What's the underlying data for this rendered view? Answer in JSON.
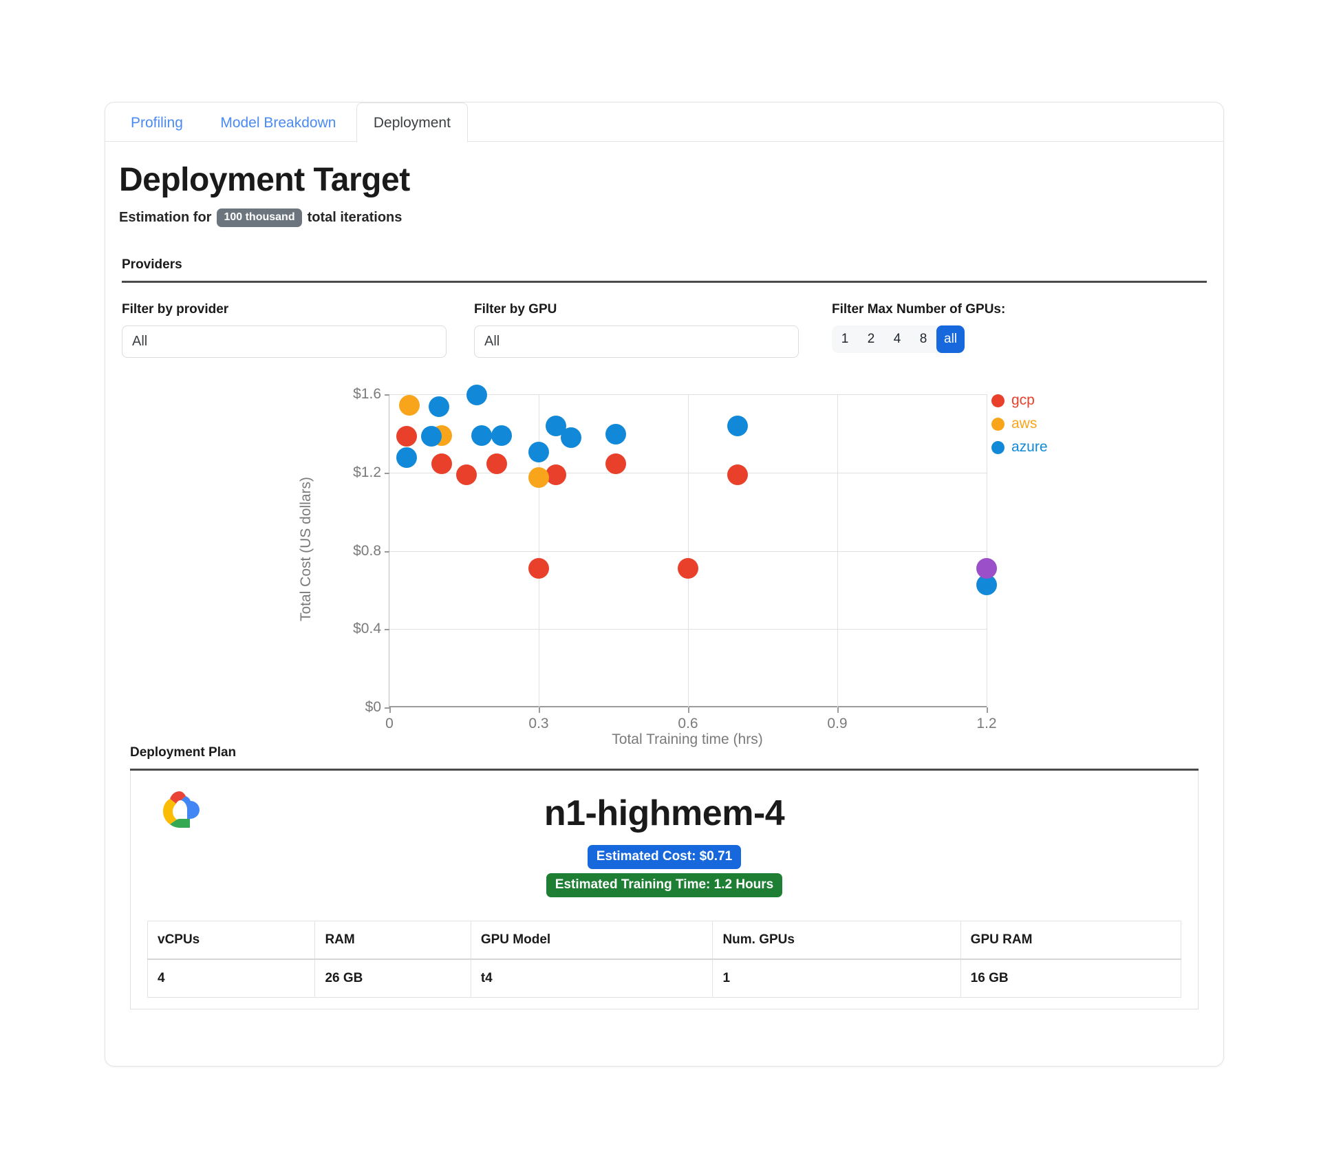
{
  "tabs": [
    {
      "label": "Profiling",
      "active": false
    },
    {
      "label": "Model Breakdown",
      "active": false
    },
    {
      "label": "Deployment",
      "active": true
    }
  ],
  "header": {
    "title": "Deployment Target",
    "subtitle_prefix": "Estimation for",
    "iterations_pill": "100 thousand",
    "subtitle_suffix": "total iterations",
    "providers_section": "Providers"
  },
  "filters": {
    "provider": {
      "label": "Filter by provider",
      "value": "All"
    },
    "gpu": {
      "label": "Filter by GPU",
      "value": "All"
    },
    "max_gpus": {
      "label": "Filter Max Number of GPUs:",
      "options": [
        "1",
        "2",
        "4",
        "8",
        "all"
      ],
      "selected": "all"
    }
  },
  "chart_data": {
    "type": "scatter",
    "title": "",
    "xlabel": "Total Training time (hrs)",
    "ylabel": "Total Cost (US dollars)",
    "xlim": [
      0,
      1.2
    ],
    "ylim": [
      0,
      1.6
    ],
    "xticks": [
      "0",
      "0.3",
      "0.6",
      "0.9",
      "1.2"
    ],
    "xtick_values": [
      0,
      0.3,
      0.6,
      0.9,
      1.2
    ],
    "yticks": [
      "$0",
      "$0.4",
      "$0.8",
      "$1.2",
      "$1.6"
    ],
    "ytick_values": [
      0,
      0.4,
      0.8,
      1.2,
      1.6
    ],
    "grid": true,
    "legend_position": "right",
    "colors": {
      "gcp": "#e8402a",
      "aws": "#f9a51b",
      "azure": "#1289d8",
      "selected": "#9b4fc8"
    },
    "legend": [
      {
        "name": "gcp",
        "color": "#e8402a"
      },
      {
        "name": "aws",
        "color": "#f9a51b"
      },
      {
        "name": "azure",
        "color": "#1289d8"
      }
    ],
    "series": [
      {
        "name": "gcp",
        "color": "#e8402a",
        "points": [
          {
            "x": 0.035,
            "y": 1.385
          },
          {
            "x": 0.105,
            "y": 1.245
          },
          {
            "x": 0.155,
            "y": 1.19
          },
          {
            "x": 0.215,
            "y": 1.245
          },
          {
            "x": 0.3,
            "y": 0.71
          },
          {
            "x": 0.335,
            "y": 1.19
          },
          {
            "x": 0.455,
            "y": 1.245
          },
          {
            "x": 0.6,
            "y": 0.71
          },
          {
            "x": 0.7,
            "y": 1.19
          }
        ]
      },
      {
        "name": "aws",
        "color": "#f9a51b",
        "points": [
          {
            "x": 0.04,
            "y": 1.545
          },
          {
            "x": 0.105,
            "y": 1.39
          },
          {
            "x": 0.3,
            "y": 1.175
          }
        ]
      },
      {
        "name": "azure",
        "color": "#1289d8",
        "points": [
          {
            "x": 0.035,
            "y": 1.275
          },
          {
            "x": 0.085,
            "y": 1.385
          },
          {
            "x": 0.1,
            "y": 1.535
          },
          {
            "x": 0.175,
            "y": 1.595
          },
          {
            "x": 0.185,
            "y": 1.39
          },
          {
            "x": 0.225,
            "y": 1.39
          },
          {
            "x": 0.3,
            "y": 1.305
          },
          {
            "x": 0.335,
            "y": 1.44
          },
          {
            "x": 0.365,
            "y": 1.38
          },
          {
            "x": 0.455,
            "y": 1.395
          },
          {
            "x": 0.7,
            "y": 1.44
          },
          {
            "x": 1.2,
            "y": 0.625
          }
        ]
      },
      {
        "name": "selected",
        "color": "#9b4fc8",
        "points": [
          {
            "x": 1.2,
            "y": 0.71
          }
        ]
      }
    ]
  },
  "deployment_plan": {
    "section_label": "Deployment Plan",
    "provider_logo": "google-cloud-logo",
    "instance_name": "n1-highmem-4",
    "cost_badge": "Estimated Cost: $0.71",
    "time_badge": "Estimated Training Time: 1.2 Hours",
    "table": {
      "headers": [
        "vCPUs",
        "RAM",
        "GPU Model",
        "Num. GPUs",
        "GPU RAM"
      ],
      "rows": [
        [
          "4",
          "26 GB",
          "t4",
          "1",
          "16 GB"
        ]
      ]
    }
  }
}
